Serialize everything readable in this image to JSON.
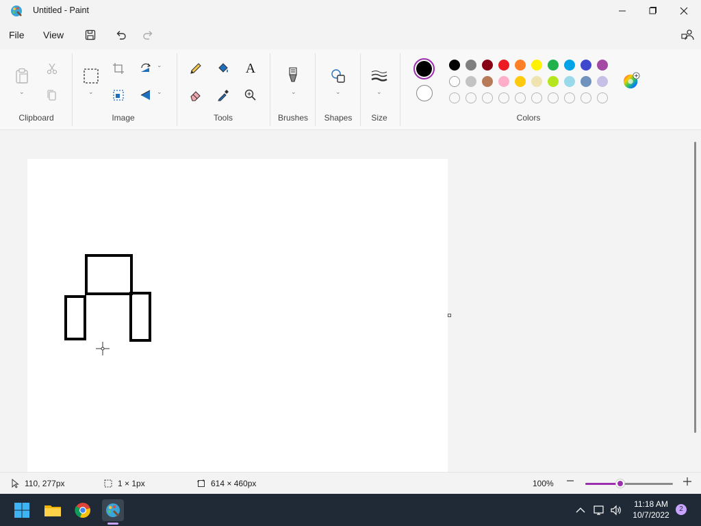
{
  "window": {
    "title": "Untitled - Paint",
    "icon": "paint-palette-icon"
  },
  "menu": {
    "file": "File",
    "view": "View",
    "icons": [
      "save-icon",
      "undo-icon",
      "redo-icon",
      "share-icon"
    ]
  },
  "ribbon": {
    "groups": {
      "clipboard": "Clipboard",
      "image": "Image",
      "tools": "Tools",
      "brushes": "Brushes",
      "shapes": "Shapes",
      "size": "Size",
      "colors": "Colors"
    },
    "text_tool_glyph": "A",
    "primary_color": "#000000",
    "secondary_color": "#ffffff",
    "palette_row1": [
      "#000000",
      "#7f7f7f",
      "#880015",
      "#ed1c24",
      "#ff7f27",
      "#fff200",
      "#22b14c",
      "#00a2e8",
      "#3f48cc",
      "#a349a4"
    ],
    "palette_row2": [
      "#ffffff",
      "#c3c3c3",
      "#b97a57",
      "#ffaec9",
      "#ffc90e",
      "#efe4b0",
      "#b5e61d",
      "#99d9ea",
      "#7092be",
      "#c8bfe7"
    ],
    "palette_row3_empty_count": 10
  },
  "status": {
    "cursor_position": "110, 277px",
    "selection_size": "1 × 1px",
    "canvas_size": "614 × 460px",
    "zoom": "100%",
    "zoom_level_fraction": 0.4
  },
  "taskbar": {
    "apps": [
      "windows-start-icon",
      "file-explorer-icon",
      "chrome-icon",
      "paint-icon"
    ],
    "time": "11:18 AM",
    "date": "10/7/2022",
    "notifications": "2"
  },
  "accent_color": "#9b2fae"
}
